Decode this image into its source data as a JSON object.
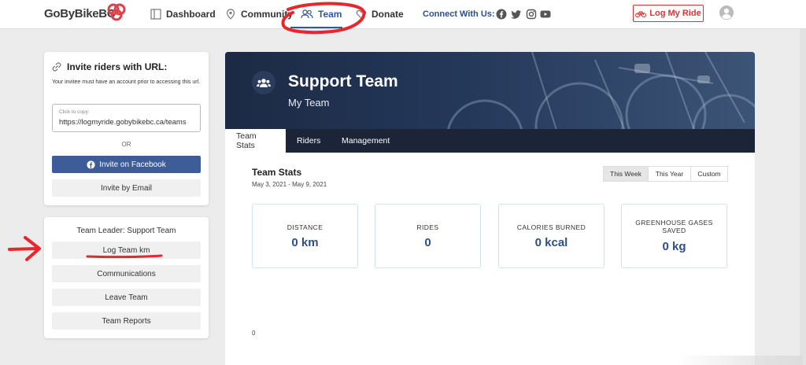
{
  "header": {
    "logo_text": "GoByBikeBC",
    "nav": {
      "dashboard": "Dashboard",
      "community": "Community",
      "team": "Team",
      "donate": "Donate"
    },
    "connect_label": "Connect With Us:",
    "log_ride_label": "Log My Ride",
    "social_icons": [
      "facebook-icon",
      "twitter-icon",
      "instagram-icon",
      "youtube-icon"
    ]
  },
  "invite": {
    "title": "Invite riders with URL:",
    "note": "Your invitee must have an account prior to accessing this url.",
    "copy_label": "Click to copy:",
    "url": "https://logmyride.gobybikebc.ca/teams",
    "or_label": "OR",
    "facebook_label": "Invite on Facebook",
    "email_label": "Invite by Email"
  },
  "leader": {
    "title": "Team Leader: Support Team",
    "buttons": [
      "Log Team km",
      "Communications",
      "Leave Team",
      "Team Reports"
    ]
  },
  "hero": {
    "title": "Support Team",
    "subtitle": "My Team",
    "tabs": [
      "Team Stats",
      "Riders",
      "Management"
    ]
  },
  "stats": {
    "title": "Team Stats",
    "date_range": "May 3, 2021 - May 9, 2021",
    "periods": [
      "This Week",
      "This Year",
      "Custom"
    ],
    "active_period": "This Week",
    "cards": [
      {
        "label": "DISTANCE",
        "value": "0 km"
      },
      {
        "label": "RIDES",
        "value": "0"
      },
      {
        "label": "CALORIES BURNED",
        "value": "0 kcal"
      },
      {
        "label": "GREENHOUSE GASES SAVED",
        "value": "0 kg"
      }
    ],
    "axis_zero": "0"
  },
  "colors": {
    "brand_blue": "#2d5a9b",
    "accent_red": "#d33333",
    "facebook_blue": "#3d5c98",
    "annotation_red": "#e8262b"
  }
}
